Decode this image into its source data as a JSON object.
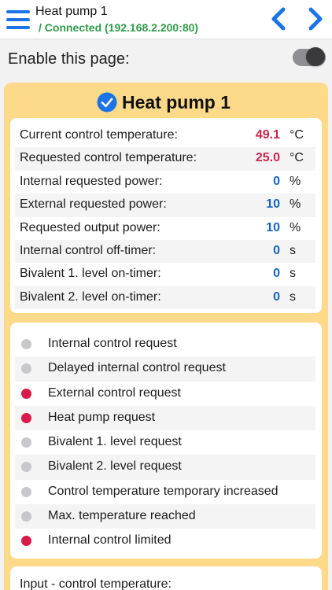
{
  "header": {
    "title": "Heat pump 1",
    "status": "/ Connected (192.168.2.200:80)"
  },
  "enable": {
    "label": "Enable this page:",
    "on": true
  },
  "panel": {
    "title": "Heat pump 1",
    "values": [
      {
        "label": "Current control temperature:",
        "value": "49.1",
        "unit": "°C",
        "color": "#d0244a"
      },
      {
        "label": "Requested control temperature:",
        "value": "25.0",
        "unit": "°C",
        "color": "#d0244a"
      },
      {
        "label": "Internal requested power:",
        "value": "0",
        "unit": "%",
        "color": "#1565c0"
      },
      {
        "label": "External requested power:",
        "value": "10",
        "unit": "%",
        "color": "#1565c0"
      },
      {
        "label": "Requested output power:",
        "value": "10",
        "unit": "%",
        "color": "#1565c0"
      },
      {
        "label": "Internal control off-timer:",
        "value": "0",
        "unit": "s",
        "color": "#1565c0"
      },
      {
        "label": "Bivalent 1. level on-timer:",
        "value": "0",
        "unit": "s",
        "color": "#1565c0"
      },
      {
        "label": "Bivalent 2. level on-timer:",
        "value": "0",
        "unit": "s",
        "color": "#1565c0"
      }
    ],
    "indicators": [
      {
        "label": "Internal control request",
        "active": false
      },
      {
        "label": "Delayed internal control request",
        "active": false
      },
      {
        "label": "External control request",
        "active": true
      },
      {
        "label": "Heat pump request",
        "active": true
      },
      {
        "label": "Bivalent 1. level request",
        "active": false
      },
      {
        "label": "Bivalent 2. level request",
        "active": false
      },
      {
        "label": "Control temperature temporary increased",
        "active": false
      },
      {
        "label": "Max. temperature reached",
        "active": false
      },
      {
        "label": "Internal control limited",
        "active": true
      }
    ],
    "next_section_label": "Input - control temperature:"
  },
  "colors": {
    "accent": "#1a73e8",
    "connected": "#2e9c48",
    "panel_bg": "#fdd98a",
    "indicator_active": "#d81b4a",
    "indicator_inactive": "#c7c7cc"
  }
}
